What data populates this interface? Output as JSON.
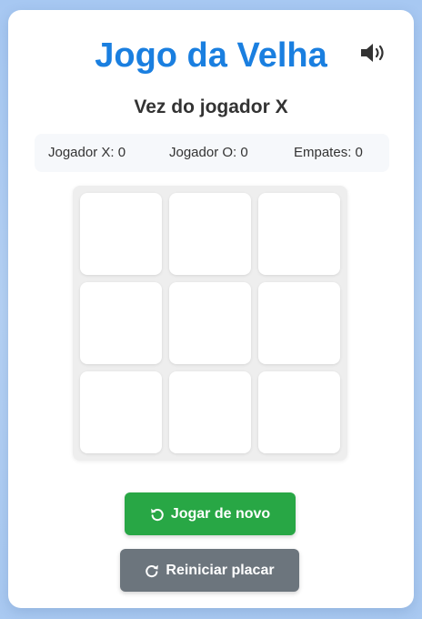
{
  "header": {
    "title": "Jogo da Velha",
    "sound_icon": "volume-up-icon"
  },
  "status": {
    "turn_text": "Vez do jogador X"
  },
  "scoreboard": {
    "player_x": "Jogador X: 0",
    "player_o": "Jogador O: 0",
    "draws": "Empates: 0"
  },
  "board": {
    "cells": [
      "",
      "",
      "",
      "",
      "",
      "",
      "",
      "",
      ""
    ]
  },
  "actions": {
    "play_again_label": "Jogar de novo",
    "play_again_icon": "undo-icon",
    "reset_score_label": "Reiniciar placar",
    "reset_score_icon": "redo-icon"
  },
  "colors": {
    "title": "#1a7fe0",
    "play_again": "#28a745",
    "reset_score": "#6c757d",
    "background": "#a7c8f2"
  }
}
